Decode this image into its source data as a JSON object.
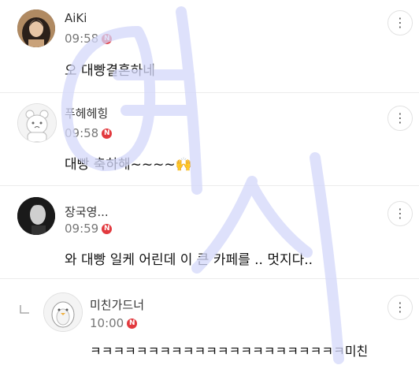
{
  "comments": [
    {
      "username": "AiKi",
      "time": "09:58",
      "badge": "N",
      "text": "오 대빵결혼하네",
      "avatar": "woman-photo-avatar"
    },
    {
      "username": "푸헤헤힝",
      "time": "09:58",
      "badge": "N",
      "text": "대빵 축하해~~~~🙌",
      "avatar": "cartoon-bear-avatar"
    },
    {
      "username": "장국영...",
      "time": "09:59",
      "badge": "N",
      "text": "와 대빵 일케 어린데 이 큰 카페를 .. 멋지다..",
      "avatar": "man-photo-avatar"
    },
    {
      "username": "미친가드너",
      "time": "10:00",
      "badge": "N",
      "text": "ㅋㅋㅋㅋㅋㅋㅋㅋㅋㅋㅋㅋㅋㅋㅋㅋㅋㅋㅋㅋㅋㅋ미친",
      "avatar": "cartoon-penguin-avatar",
      "is_reply": true
    }
  ],
  "more_icon": "⋮",
  "accent_color": "#e2393e",
  "watermark_color": "#d8dafa"
}
